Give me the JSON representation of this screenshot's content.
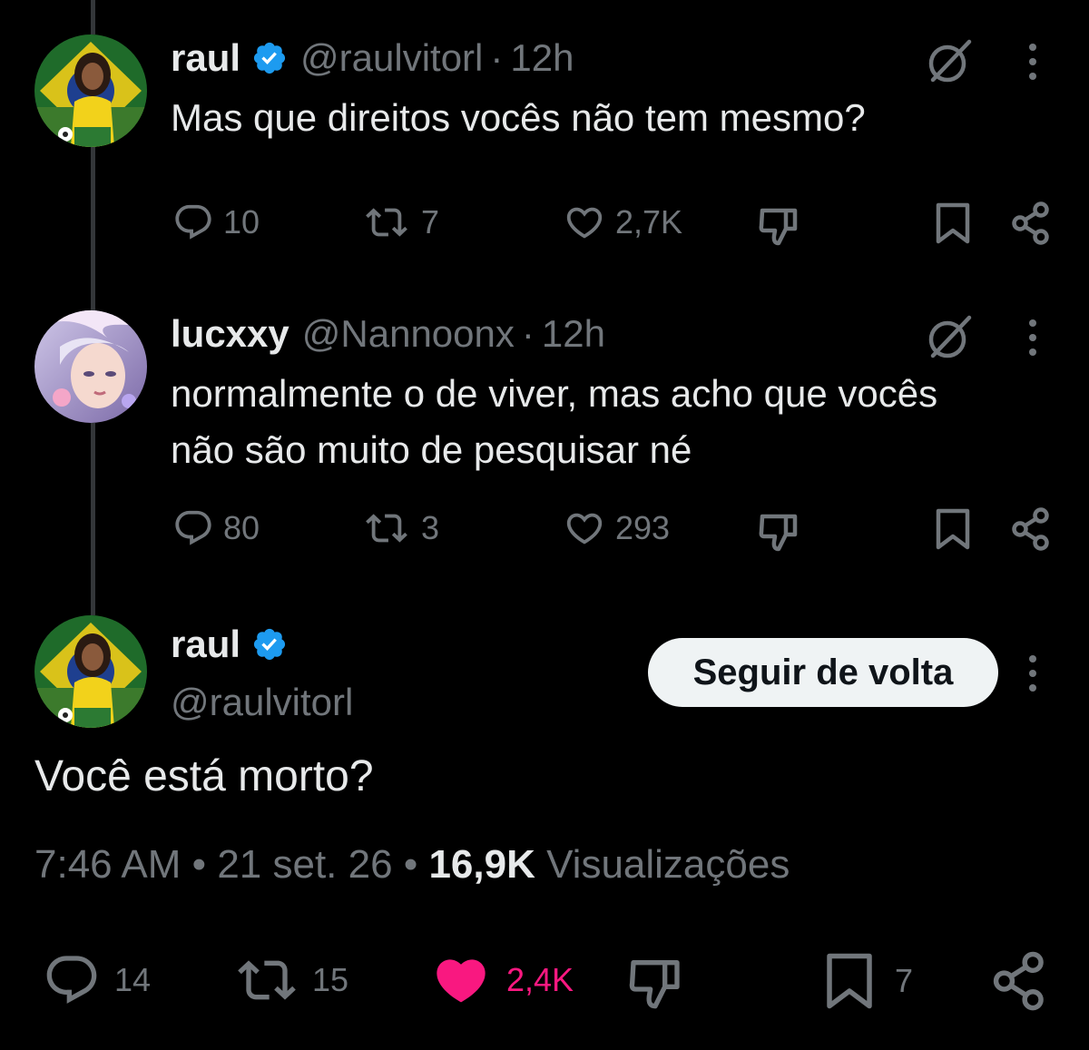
{
  "colors": {
    "background": "#000000",
    "text": "#e7e9ea",
    "muted": "#71767b",
    "verified": "#1d9bf0",
    "like_active": "#f91880",
    "follow_button_bg": "#eff3f4"
  },
  "tweets": [
    {
      "name": "raul",
      "verified": true,
      "handle": "@raulvitorl",
      "separator": "·",
      "time": "12h",
      "text": "Mas que direitos vocês não tem mesmo?",
      "replies": "10",
      "reposts": "7",
      "likes": "2,7K"
    },
    {
      "name": "lucxxy",
      "verified": false,
      "handle": "@Nannoonx",
      "separator": "·",
      "time": "12h",
      "text_line1": "normalmente o de viver, mas acho que vocês",
      "text_line2": "não são muito de pesquisar né",
      "replies": "80",
      "reposts": "3",
      "likes": "293"
    }
  ],
  "main_tweet": {
    "name": "raul",
    "verified": true,
    "handle": "@raulvitorl",
    "follow_button": "Seguir de volta",
    "text": "Você está morto?",
    "time": "7:46 AM",
    "sep1": "•",
    "date": "21 set. 26",
    "sep2": "•",
    "views": "16,9K",
    "views_label": "Visualizações",
    "replies": "14",
    "reposts": "15",
    "likes": "2,4K",
    "bookmarks": "7"
  },
  "icons": {
    "reply": "reply-icon",
    "repost": "repost-icon",
    "like": "heart-icon",
    "dislike": "dislike-icon",
    "bookmark": "bookmark-icon",
    "share": "share-icon",
    "grok": "grok-icon",
    "more": "more-icon",
    "verified": "verified-badge-icon"
  }
}
